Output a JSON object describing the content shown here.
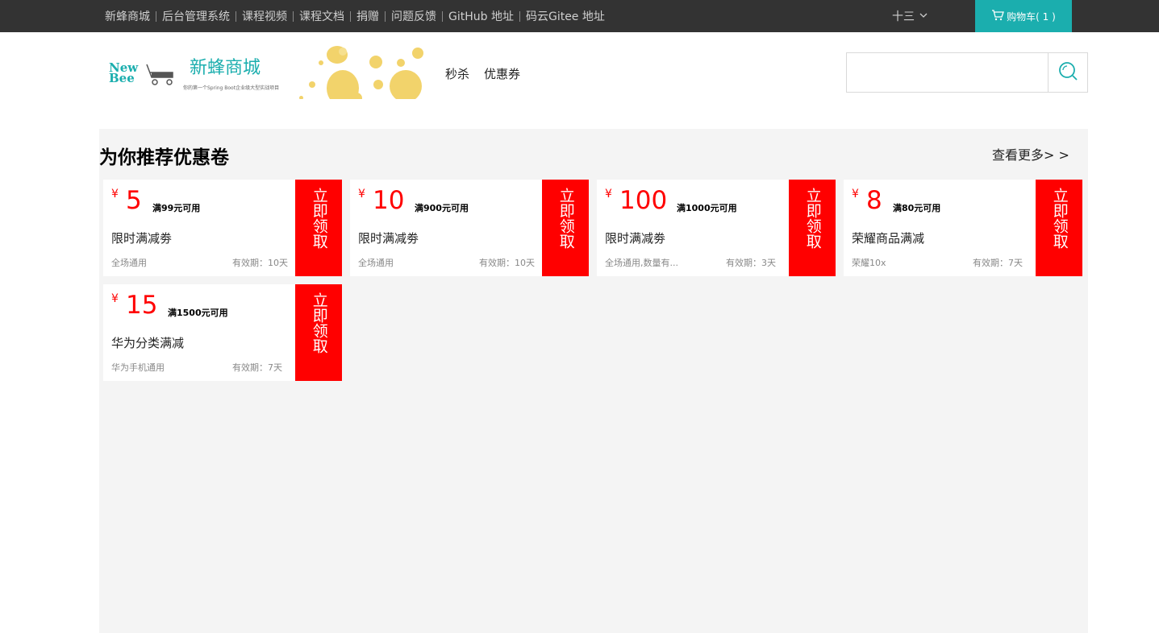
{
  "topnav": {
    "items": [
      "新蜂商城",
      "后台管理系统",
      "课程视频",
      "课程文档",
      "捐赠",
      "问题反馈",
      "GitHub 地址",
      "码云Gitee 地址"
    ]
  },
  "user": {
    "name": "十三",
    "icon": "chevron-down-icon"
  },
  "cart": {
    "label": "购物车( 1 )",
    "icon": "cart-icon",
    "color": "#1baeae"
  },
  "header": {
    "logo_short_1": "New",
    "logo_short_2": "Bee",
    "brand": "新蜂商城",
    "slogan": "你的第一个Spring Boot企业级大型实战项目",
    "nav": [
      "秒杀",
      "优惠券"
    ],
    "search_placeholder": "",
    "search_icon": "search-icon"
  },
  "section": {
    "title": "为你推荐优惠卷",
    "more": "查看更多> >"
  },
  "coupons": [
    {
      "currency": "¥",
      "amount": "5",
      "condition": "满99元可用",
      "name": "限时满减劵",
      "scope": "全场通用",
      "validity": "有效期：10天",
      "claim": "立即领取"
    },
    {
      "currency": "¥",
      "amount": "10",
      "condition": "满900元可用",
      "name": "限时满减劵",
      "scope": "全场通用",
      "validity": "有效期：10天",
      "claim": "立即领取"
    },
    {
      "currency": "¥",
      "amount": "100",
      "condition": "满1000元可用",
      "name": "限时满减劵",
      "scope": "全场通用,数量有...",
      "validity": "有效期：3天",
      "claim": "立即领取"
    },
    {
      "currency": "¥",
      "amount": "8",
      "condition": "满80元可用",
      "name": "荣耀商品满减",
      "scope": "荣耀10x",
      "validity": "有效期：7天",
      "claim": "立即领取"
    },
    {
      "currency": "¥",
      "amount": "15",
      "condition": "满1500元可用",
      "name": "华为分类满减",
      "scope": "华为手机通用",
      "validity": "有效期：7天",
      "claim": "立即领取"
    }
  ],
  "colors": {
    "accent": "#ff0000",
    "topbar": "#333333",
    "panel": "#f4f4f4"
  }
}
